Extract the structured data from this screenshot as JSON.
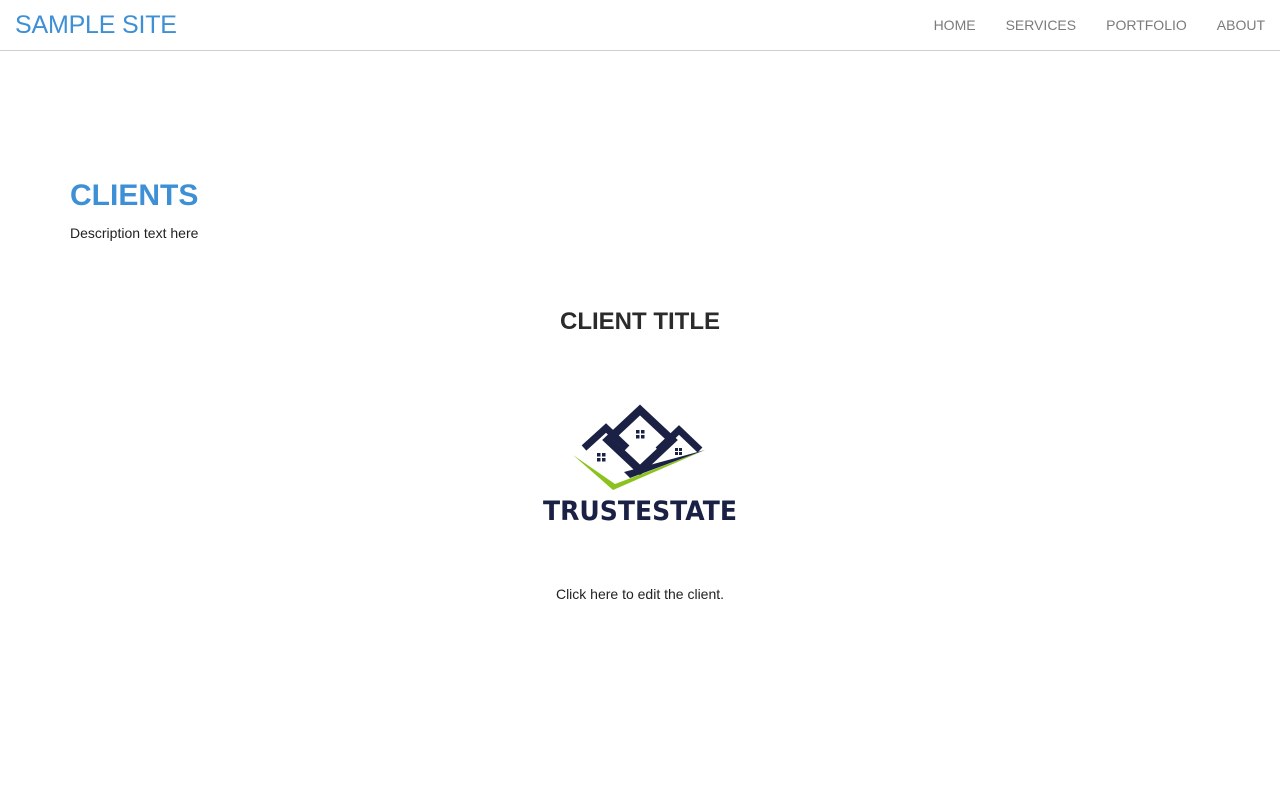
{
  "header": {
    "brand": "SAMPLE SITE",
    "nav": [
      "HOME",
      "SERVICES",
      "PORTFOLIO",
      "ABOUT"
    ]
  },
  "section": {
    "title": "CLIENTS",
    "description": "Description text here"
  },
  "client": {
    "title": "CLIENT TITLE",
    "logo_text": "TRUSTESTATE",
    "edit_link": "Click here to edit the client."
  },
  "colors": {
    "accent": "#3d8fd6",
    "nav_text": "#7b7b7b",
    "logo_navy": "#1b2144",
    "logo_green": "#8cc21f"
  }
}
